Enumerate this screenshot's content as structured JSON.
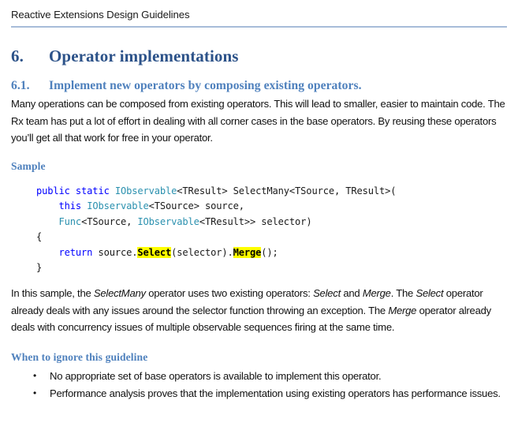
{
  "header": {
    "title": "Reactive Extensions Design Guidelines",
    "rule_color": "#a7bcd9"
  },
  "section": {
    "number": "6.",
    "title": "Operator implementations",
    "color": "#2c5289"
  },
  "subsection": {
    "number": "6.1.",
    "title": "Implement new operators by composing existing operators.",
    "color": "#4f81bd",
    "paragraph": "Many operations can be composed from existing operators. This will lead to smaller, easier to maintain code. The Rx team has put a lot of effort in dealing with all corner cases in the base operators. By reusing these operators you’ll get all that work for free in your operator."
  },
  "sample": {
    "label": "Sample",
    "code_lines": [
      {
        "tokens": [
          {
            "text": "public static ",
            "kind": "keyword"
          },
          {
            "text": "IObservable",
            "kind": "type"
          },
          {
            "text": "<TResult> SelectMany<TSource, TResult>(",
            "kind": "plain"
          }
        ]
      },
      {
        "tokens": [
          {
            "text": "    ",
            "kind": "plain"
          },
          {
            "text": "this ",
            "kind": "keyword"
          },
          {
            "text": "IObservable",
            "kind": "type"
          },
          {
            "text": "<TSource> source,",
            "kind": "plain"
          }
        ]
      },
      {
        "tokens": [
          {
            "text": "    ",
            "kind": "plain"
          },
          {
            "text": "Func",
            "kind": "type"
          },
          {
            "text": "<TSource, ",
            "kind": "plain"
          },
          {
            "text": "IObservable",
            "kind": "type"
          },
          {
            "text": "<TResult>> selector)",
            "kind": "plain"
          }
        ]
      },
      {
        "tokens": [
          {
            "text": "{",
            "kind": "plain"
          }
        ]
      },
      {
        "tokens": [
          {
            "text": "    ",
            "kind": "plain"
          },
          {
            "text": "return ",
            "kind": "keyword"
          },
          {
            "text": "source.",
            "kind": "plain"
          },
          {
            "text": "Select",
            "kind": "highlight"
          },
          {
            "text": "(selector).",
            "kind": "plain"
          },
          {
            "text": "Merge",
            "kind": "highlight"
          },
          {
            "text": "();",
            "kind": "plain"
          }
        ]
      },
      {
        "tokens": [
          {
            "text": "}",
            "kind": "plain"
          }
        ]
      }
    ],
    "syntax_colors": {
      "keyword": "#0000ff",
      "type": "#2b91af",
      "plain": "#1a1a1a",
      "highlight_background": "#ffff00",
      "highlight_text": "#000000"
    }
  },
  "explanation": {
    "runs": [
      {
        "text": "In this sample, the ",
        "style": "normal"
      },
      {
        "text": "SelectMany",
        "style": "italic"
      },
      {
        "text": " operator uses two existing operators: ",
        "style": "normal"
      },
      {
        "text": "Select",
        "style": "italic"
      },
      {
        "text": " and ",
        "style": "normal"
      },
      {
        "text": "Merge",
        "style": "italic"
      },
      {
        "text": ". The ",
        "style": "normal"
      },
      {
        "text": "Select",
        "style": "italic"
      },
      {
        "text": " operator already deals with any issues around the selector function throwing an exception. The ",
        "style": "normal"
      },
      {
        "text": "Merge",
        "style": "italic"
      },
      {
        "text": " operator already deals with concurrency issues of multiple observable sequences firing at the same time.",
        "style": "normal"
      }
    ]
  },
  "ignore_guideline": {
    "heading": "When to ignore this guideline",
    "bullet_glyph": "•",
    "items": [
      "No appropriate set of base operators is available to implement this operator.",
      "Performance analysis proves that the implementation using existing operators has performance issues."
    ]
  }
}
